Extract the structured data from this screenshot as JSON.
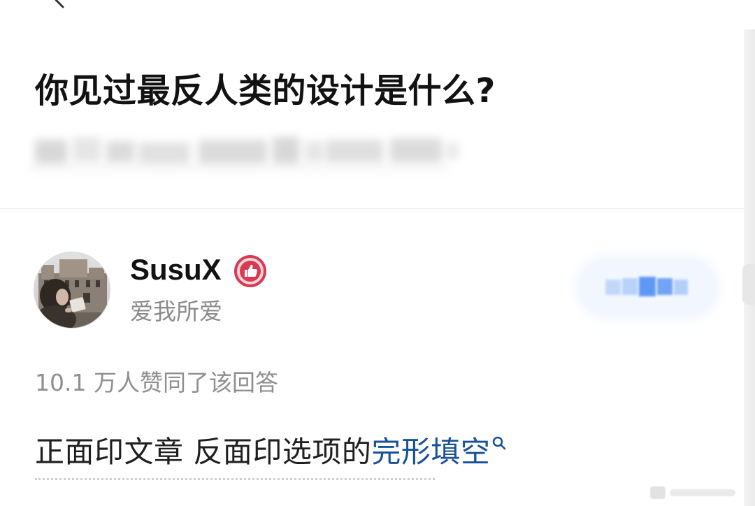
{
  "question": {
    "title": "你见过最反人类的设计是什么?"
  },
  "author": {
    "name": "SusuX",
    "bio": "爱我所爱",
    "badge_icon": "thumbs-up-badge-icon"
  },
  "follow_button": {
    "label": "",
    "accent": "#1772f6"
  },
  "answer": {
    "vote_count_text": "10.1 万人赞同了该回答",
    "text_prefix": "正面印文章 反面印选项的",
    "link_text": "完形填空"
  },
  "colors": {
    "title": "#121212",
    "secondary": "#8b8b8b",
    "link": "#175199",
    "badge": "#d63b53"
  },
  "icons": {
    "back": "chevron-left-icon",
    "search": "search-icon"
  }
}
